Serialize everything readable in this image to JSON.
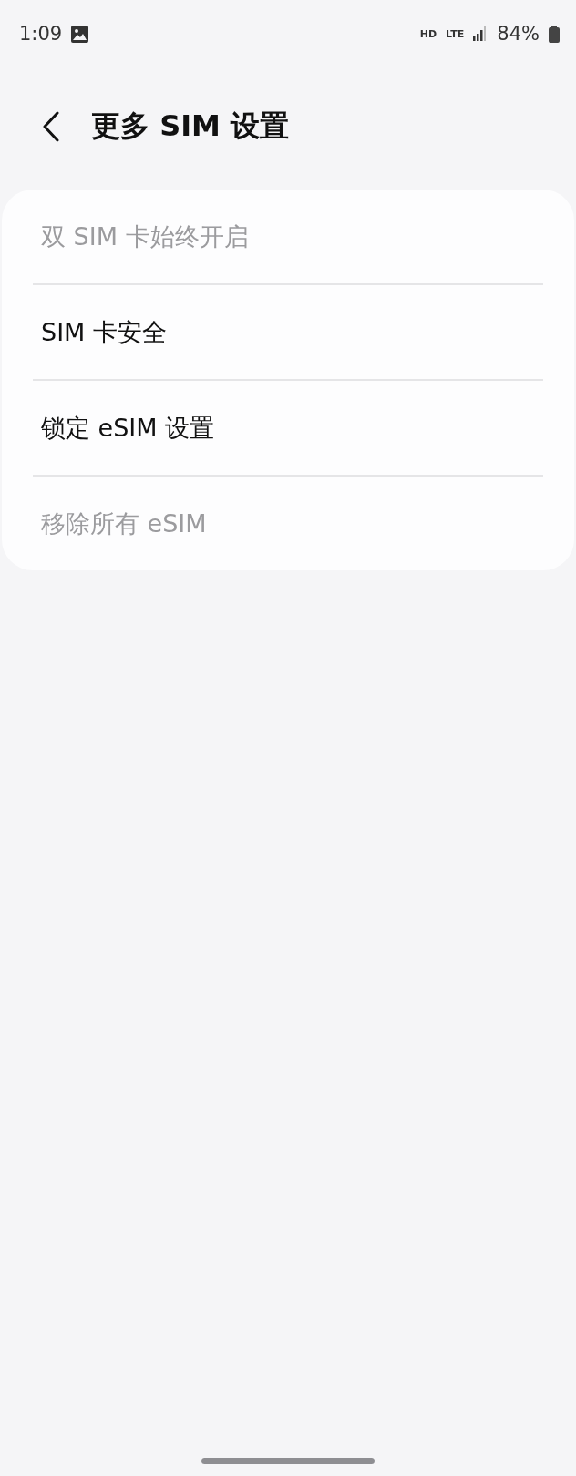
{
  "status_bar": {
    "time": "1:09",
    "hd": "HD",
    "network": "LTE",
    "battery": "84%"
  },
  "header": {
    "title": "更多 SIM 设置"
  },
  "items": [
    {
      "label": "双 SIM 卡始终开启",
      "disabled": true
    },
    {
      "label": "SIM 卡安全",
      "disabled": false
    },
    {
      "label": "锁定 eSIM 设置",
      "disabled": false
    },
    {
      "label": "移除所有 eSIM",
      "disabled": true
    }
  ]
}
